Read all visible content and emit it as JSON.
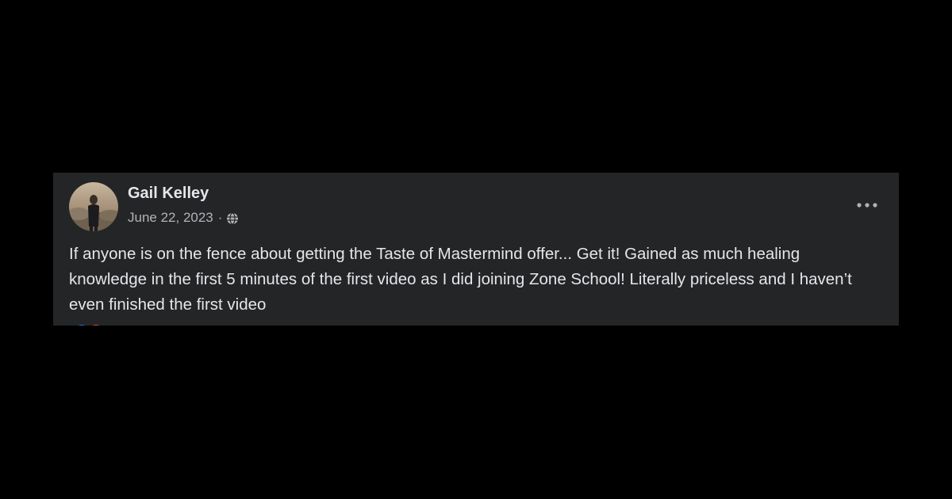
{
  "post": {
    "author_name": "Gail Kelley",
    "date": "June 22, 2023",
    "separator": "·",
    "privacy_icon": "globe-icon",
    "more_icon": "more-options-icon",
    "text": "If anyone is on the fence about getting the Taste of Mastermind offer... Get it! Gained as much healing knowledge in the first 5 minutes of the first video as I did joining Zone School! Literally priceless and I haven’t even finished the first video",
    "reactions": [
      "like-icon",
      "love-icon"
    ]
  },
  "colors": {
    "page_background": "#000000",
    "card_background": "#242526",
    "primary_text": "#e4e6eb",
    "secondary_text": "#b0b3b8",
    "like_blue": "#1877f2",
    "love_red": "#f33e58"
  }
}
